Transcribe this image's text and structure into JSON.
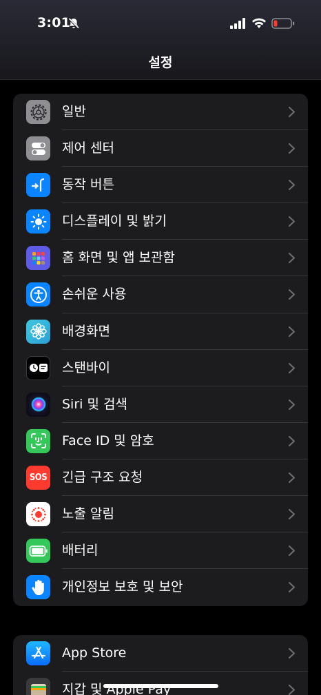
{
  "status_bar": {
    "time": "3:01",
    "icons": [
      "bell-off-icon",
      "signal-icon",
      "wifi-icon",
      "battery-low-icon"
    ]
  },
  "header": {
    "title": "설정"
  },
  "groups": [
    {
      "items": [
        {
          "label": "일반",
          "icon": "gear-icon",
          "color": "#8e8e93"
        },
        {
          "label": "제어 센터",
          "icon": "toggles-icon",
          "color": "#8e8e93"
        },
        {
          "label": "동작 버튼",
          "icon": "action-button-icon",
          "color": "#0a84ff"
        },
        {
          "label": "디스플레이 및 밝기",
          "icon": "sun-icon",
          "color": "#0a84ff"
        },
        {
          "label": "홈 화면 및 앱 보관함",
          "icon": "app-grid-icon",
          "color": "#5e5ce6"
        },
        {
          "label": "손쉬운 사용",
          "icon": "accessibility-icon",
          "color": "#0a84ff"
        },
        {
          "label": "배경화면",
          "icon": "flower-icon",
          "color": "#30b0e0"
        },
        {
          "label": "스탠바이",
          "icon": "standby-icon",
          "color": "#000000"
        },
        {
          "label": "Siri 및 검색",
          "icon": "siri-icon",
          "color": "#1a1a2e"
        },
        {
          "label": "Face ID 및 암호",
          "icon": "face-id-icon",
          "color": "#34c759"
        },
        {
          "label": "긴급 구조 요청",
          "icon": "sos-icon",
          "icon_text": "SOS",
          "color": "#ff3b30"
        },
        {
          "label": "노출 알림",
          "icon": "exposure-icon",
          "color": "#ffffff"
        },
        {
          "label": "배터리",
          "icon": "battery-icon",
          "color": "#34c759"
        },
        {
          "label": "개인정보 보호 및 보안",
          "icon": "hand-icon",
          "color": "#0a84ff"
        }
      ]
    },
    {
      "items": [
        {
          "label": "App Store",
          "icon": "app-store-icon",
          "color": "#0a84ff"
        },
        {
          "label": "지갑 및 Apple Pay",
          "icon": "wallet-icon",
          "color": "#3a3a3c"
        }
      ]
    }
  ]
}
